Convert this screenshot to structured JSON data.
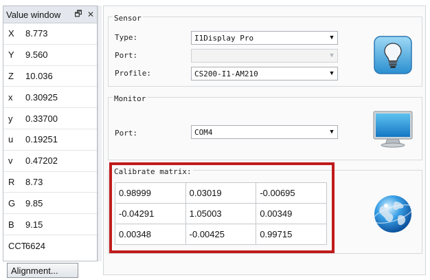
{
  "value_window": {
    "title": "Value window",
    "rows": [
      {
        "label": "X",
        "value": "8.773"
      },
      {
        "label": "Y",
        "value": "9.560"
      },
      {
        "label": "Z",
        "value": "10.036"
      },
      {
        "label": "x",
        "value": "0.30925"
      },
      {
        "label": "y",
        "value": "0.33700"
      },
      {
        "label": "u",
        "value": "0.19251"
      },
      {
        "label": "v",
        "value": "0.47202"
      },
      {
        "label": "R",
        "value": "8.73"
      },
      {
        "label": "G",
        "value": "9.85"
      },
      {
        "label": "B",
        "value": "9.15"
      },
      {
        "label": "CCT",
        "value": "6624"
      }
    ]
  },
  "alignment_button": "Alignment...",
  "sensor": {
    "legend": "Sensor",
    "type_label": "Type:",
    "type_value": "I1Display Pro",
    "port_label": "Port:",
    "port_value": "",
    "profile_label": "Profile:",
    "profile_value": "CS200-I1-AM210"
  },
  "monitor": {
    "legend": "Monitor",
    "port_label": "Port:",
    "port_value": "COM4"
  },
  "calibrate": {
    "legend": "Calibrate matrix:",
    "matrix": [
      [
        "0.98999",
        "0.03019",
        "-0.00695"
      ],
      [
        "-0.04291",
        "1.05003",
        "0.00349"
      ],
      [
        "0.00348",
        "-0.00425",
        "0.99715"
      ]
    ]
  },
  "colors": {
    "highlight_frame": "#c01b1b",
    "title_bar": "#e4e8ee"
  },
  "icons": {
    "pin": "pin-icon",
    "close": "close-icon",
    "sensor": "lightbulb-icon",
    "monitor": "monitor-icon",
    "calibrate": "globe-icon"
  }
}
